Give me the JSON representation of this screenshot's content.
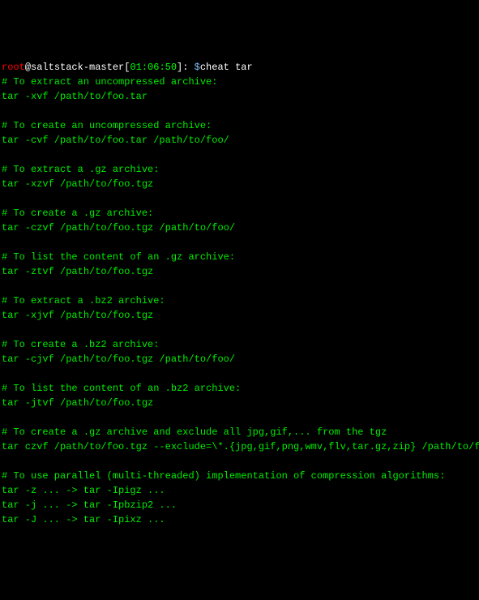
{
  "prompt": {
    "user": "root",
    "at": "@",
    "host": "saltstack-master",
    "time_open": "[",
    "time": "01:06:50",
    "time_close": "]:",
    "dollar": "$",
    "command": "cheat tar"
  },
  "lines": [
    {
      "type": "comment",
      "text": "# To extract an uncompressed archive:"
    },
    {
      "type": "command",
      "text": "tar -xvf /path/to/foo.tar"
    },
    {
      "type": "blank",
      "text": ""
    },
    {
      "type": "comment",
      "text": "# To create an uncompressed archive:"
    },
    {
      "type": "command",
      "text": "tar -cvf /path/to/foo.tar /path/to/foo/"
    },
    {
      "type": "blank",
      "text": ""
    },
    {
      "type": "comment",
      "text": "# To extract a .gz archive:"
    },
    {
      "type": "command",
      "text": "tar -xzvf /path/to/foo.tgz"
    },
    {
      "type": "blank",
      "text": ""
    },
    {
      "type": "comment",
      "text": "# To create a .gz archive:"
    },
    {
      "type": "command",
      "text": "tar -czvf /path/to/foo.tgz /path/to/foo/"
    },
    {
      "type": "blank",
      "text": ""
    },
    {
      "type": "comment",
      "text": "# To list the content of an .gz archive:"
    },
    {
      "type": "command",
      "text": "tar -ztvf /path/to/foo.tgz"
    },
    {
      "type": "blank",
      "text": ""
    },
    {
      "type": "comment",
      "text": "# To extract a .bz2 archive:"
    },
    {
      "type": "command",
      "text": "tar -xjvf /path/to/foo.tgz"
    },
    {
      "type": "blank",
      "text": ""
    },
    {
      "type": "comment",
      "text": "# To create a .bz2 archive:"
    },
    {
      "type": "command",
      "text": "tar -cjvf /path/to/foo.tgz /path/to/foo/"
    },
    {
      "type": "blank",
      "text": ""
    },
    {
      "type": "comment",
      "text": "# To list the content of an .bz2 archive:"
    },
    {
      "type": "command",
      "text": "tar -jtvf /path/to/foo.tgz"
    },
    {
      "type": "blank",
      "text": ""
    },
    {
      "type": "comment",
      "text": "# To create a .gz archive and exclude all jpg,gif,... from the tgz"
    },
    {
      "type": "command",
      "text": "tar czvf /path/to/foo.tgz --exclude=\\*.{jpg,gif,png,wmv,flv,tar.gz,zip} /path/to/foo/"
    },
    {
      "type": "blank",
      "text": ""
    },
    {
      "type": "comment",
      "text": "# To use parallel (multi-threaded) implementation of compression algorithms:"
    },
    {
      "type": "command",
      "text": "tar -z ... -> tar -Ipigz ..."
    },
    {
      "type": "command",
      "text": "tar -j ... -> tar -Ipbzip2 ..."
    },
    {
      "type": "command",
      "text": "tar -J ... -> tar -Ipixz ..."
    }
  ]
}
